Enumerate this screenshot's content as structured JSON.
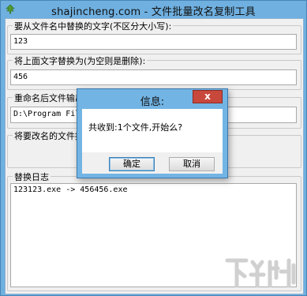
{
  "window": {
    "title": "shajincheng.com - 文件批量改名复制工具",
    "icon": "app-leaf-icon"
  },
  "find_group": {
    "label": "要从文件名中替换的文字(不区分大小写):",
    "value": "123"
  },
  "replace_group": {
    "label": "将上面文字替换为(为空则是删除):",
    "value": "456"
  },
  "output_group": {
    "label": "重命名后文件输出目",
    "value": "D:\\Program Files\\2"
  },
  "drop_group": {
    "label": "将要改名的文件拖拽"
  },
  "log_group": {
    "label": "替换日志",
    "lines": [
      "123123.exe -> 456456.exe"
    ]
  },
  "dialog": {
    "title": "信息:",
    "message": "共收到:1个文件,开始么?",
    "ok_label": "确定",
    "cancel_label": "取消",
    "close_glyph": "x"
  },
  "watermark": {
    "icon": "xiazaiba-logo-icon"
  },
  "colors": {
    "titlebar": "#6fb0e0",
    "close_button": "#c9483c",
    "client_bg": "#f0f0f0"
  }
}
